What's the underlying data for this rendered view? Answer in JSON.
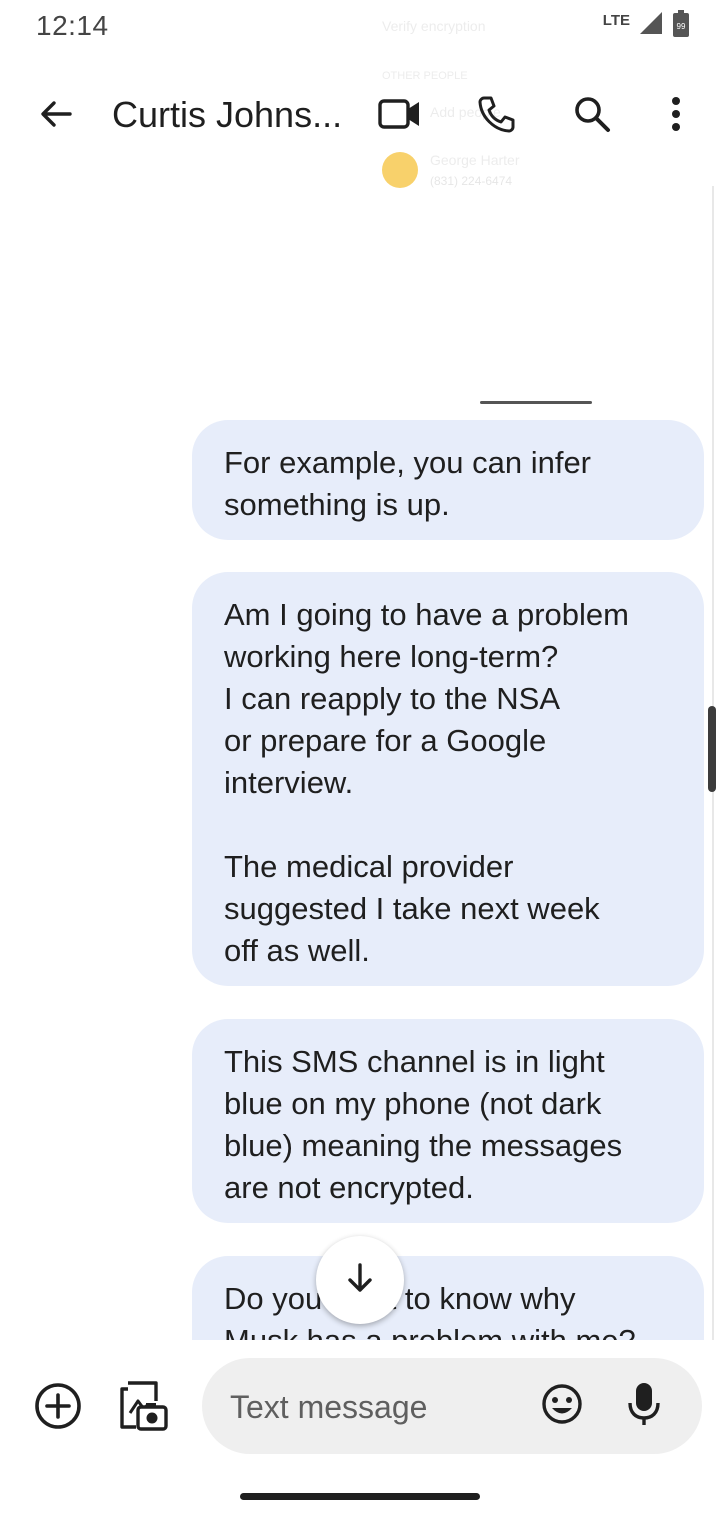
{
  "status_bar": {
    "time": "12:14",
    "network": "LTE",
    "battery_level": "99"
  },
  "ghost_overlay": {
    "line1": "Verify encryption",
    "line2": "OTHER PEOPLE",
    "line3": "Add people",
    "line4": "George Harter",
    "line5": "(831) 224-6474"
  },
  "header": {
    "contact_name": "Curtis Johns...",
    "icons": [
      "back-arrow-icon",
      "video-call-icon",
      "phone-call-icon",
      "search-icon",
      "more-vert-icon"
    ]
  },
  "messages": [
    {
      "text": "For example, you can infer\nsomething is up."
    },
    {
      "text": "Am I going to have a problem\nworking here long-term?\nI can reapply to the NSA\nor prepare for a Google\ninterview.\n\nThe medical provider\nsuggested I take next week\noff as well."
    },
    {
      "text": "This SMS channel is in light\nblue on my phone (not dark\nblue) meaning the messages\nare not encrypted."
    },
    {
      "text": "Do you want to know why\nMusk has a problem with me?"
    }
  ],
  "compose": {
    "placeholder": "Text message",
    "icons": [
      "add-circle-icon",
      "gallery-camera-icon",
      "emoji-icon",
      "microphone-icon"
    ]
  },
  "colors": {
    "bubble": "#e7edfa",
    "compose_field": "#efefef",
    "text": "#1f1f1f"
  }
}
